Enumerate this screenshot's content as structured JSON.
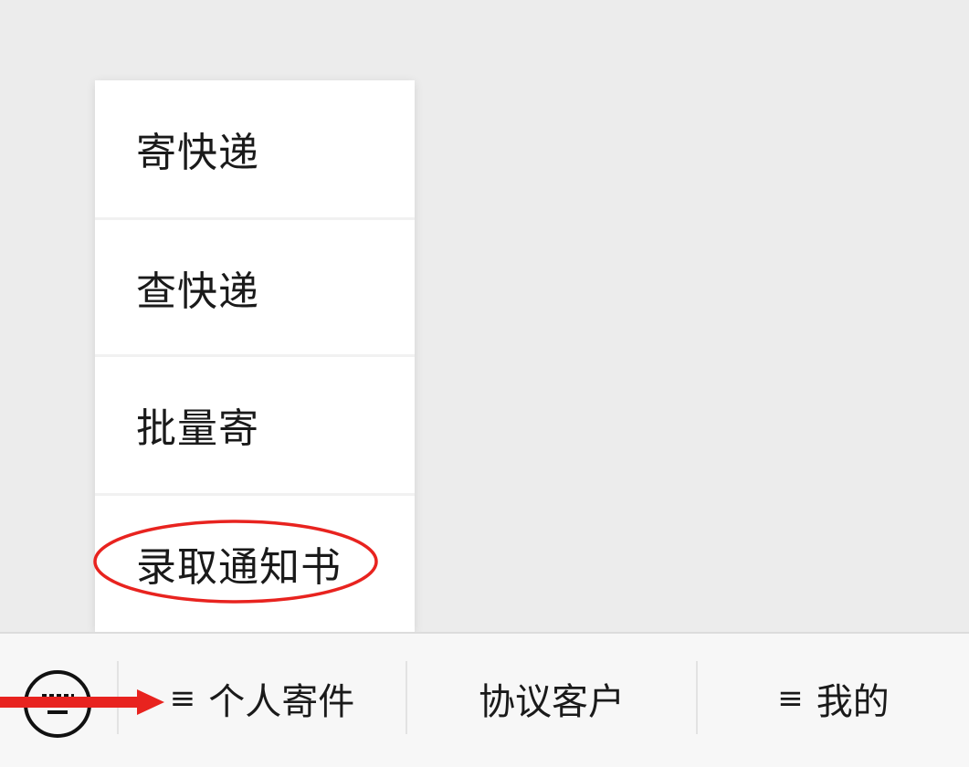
{
  "popup_menu": {
    "items": [
      {
        "label": "寄快递"
      },
      {
        "label": "查快递"
      },
      {
        "label": "批量寄"
      },
      {
        "label": "录取通知书"
      }
    ]
  },
  "menu_bar": {
    "keyboard_toggle_icon": "keyboard-icon",
    "items": [
      {
        "label": "个人寄件",
        "has_submenu": true,
        "icon": "menu-lines-icon"
      },
      {
        "label": "协议客户",
        "has_submenu": false
      },
      {
        "label": "我的",
        "has_submenu": true,
        "icon": "menu-lines-icon"
      }
    ]
  },
  "annotation": {
    "highlight_color": "#e8231f"
  }
}
